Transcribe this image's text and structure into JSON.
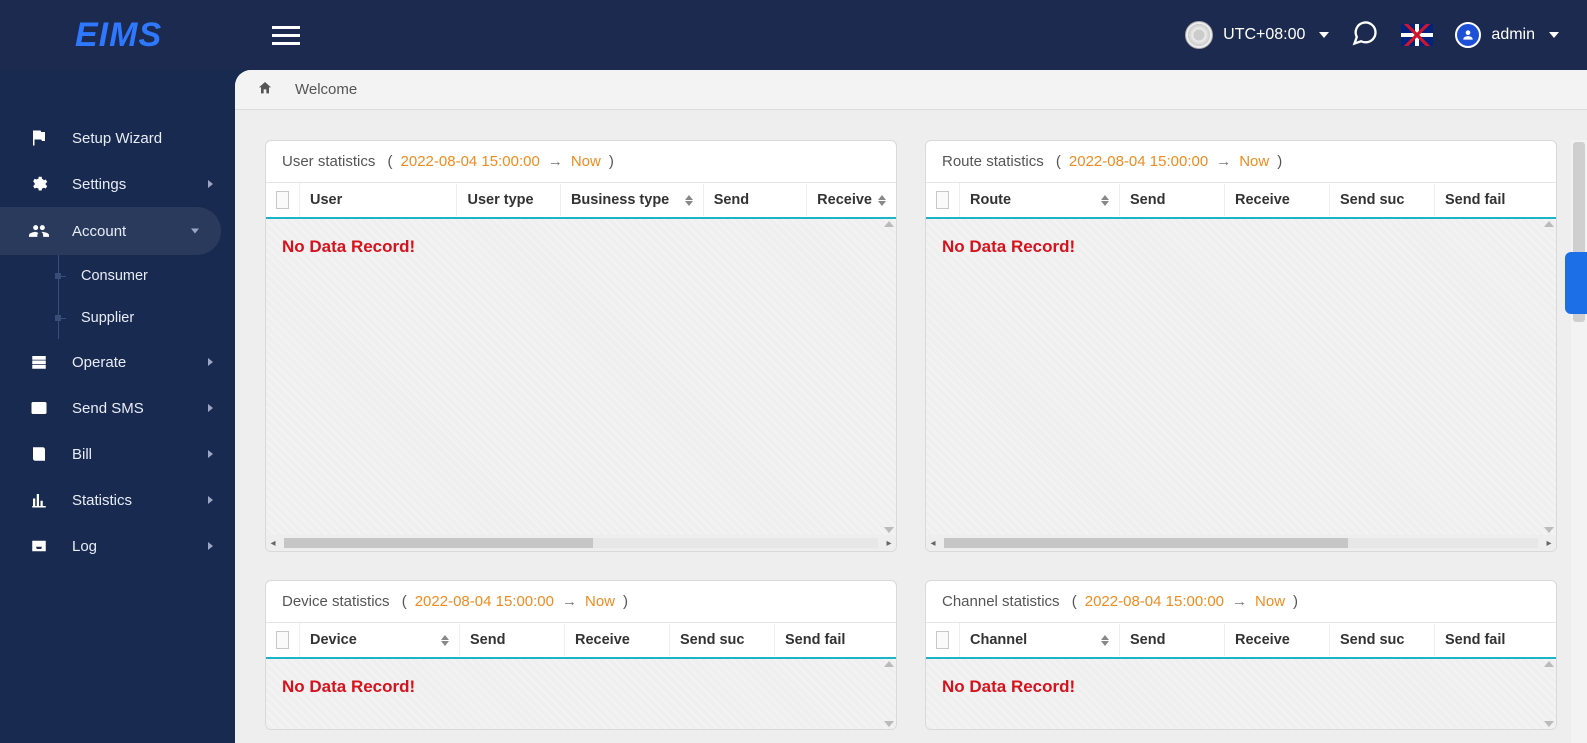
{
  "brand": "EIMS",
  "topbar": {
    "timezone": "UTC+08:00",
    "username": "admin"
  },
  "tab": {
    "title": "Welcome"
  },
  "sidebar": {
    "items": [
      {
        "label": "Setup Wizard",
        "icon": "flag",
        "has_sub": false
      },
      {
        "label": "Settings",
        "icon": "gear",
        "has_sub": true
      },
      {
        "label": "Account",
        "icon": "users",
        "has_sub": true,
        "active": true,
        "children": [
          {
            "label": "Consumer"
          },
          {
            "label": "Supplier"
          }
        ]
      },
      {
        "label": "Operate",
        "icon": "server",
        "has_sub": true
      },
      {
        "label": "Send SMS",
        "icon": "envelope",
        "has_sub": true
      },
      {
        "label": "Bill",
        "icon": "book",
        "has_sub": true
      },
      {
        "label": "Statistics",
        "icon": "stats",
        "has_sub": true
      },
      {
        "label": "Log",
        "icon": "inbox",
        "has_sub": true
      }
    ]
  },
  "date_range": {
    "from": "2022-08-04 15:00:00",
    "to": "Now"
  },
  "no_data_text": "No Data Record!",
  "panels": {
    "user": {
      "title": "User statistics",
      "columns": [
        "User",
        "User type",
        "Business type",
        "Send",
        "Receive"
      ]
    },
    "route": {
      "title": "Route statistics",
      "columns": [
        "Route",
        "Send",
        "Receive",
        "Send suc",
        "Send fail"
      ]
    },
    "device": {
      "title": "Device statistics",
      "columns": [
        "Device",
        "Send",
        "Receive",
        "Send suc",
        "Send fail"
      ]
    },
    "channel": {
      "title": "Channel statistics",
      "columns": [
        "Channel",
        "Send",
        "Receive",
        "Send suc",
        "Send fail"
      ]
    }
  }
}
